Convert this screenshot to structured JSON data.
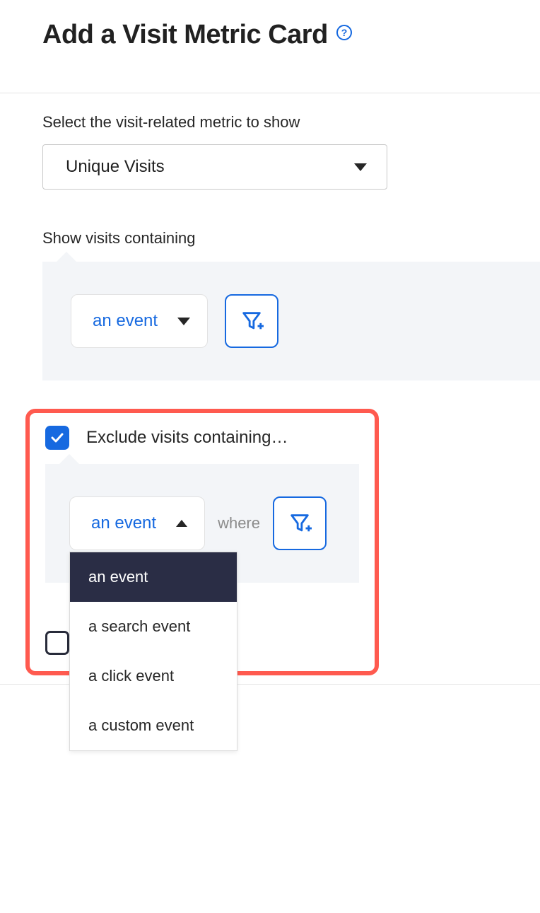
{
  "header": {
    "title": "Add a Visit Metric Card",
    "help_glyph": "?"
  },
  "metric_section": {
    "label": "Select the visit-related metric to show",
    "selected": "Unique Visits"
  },
  "show_section": {
    "label": "Show visits containing",
    "selector_value": "an event"
  },
  "exclude_section": {
    "checkbox_label": "Exclude visits containing…",
    "checked": true,
    "selector_value": "an event",
    "where_label": "where",
    "options": [
      "an event",
      "a search event",
      "a click event",
      "a custom event"
    ]
  }
}
